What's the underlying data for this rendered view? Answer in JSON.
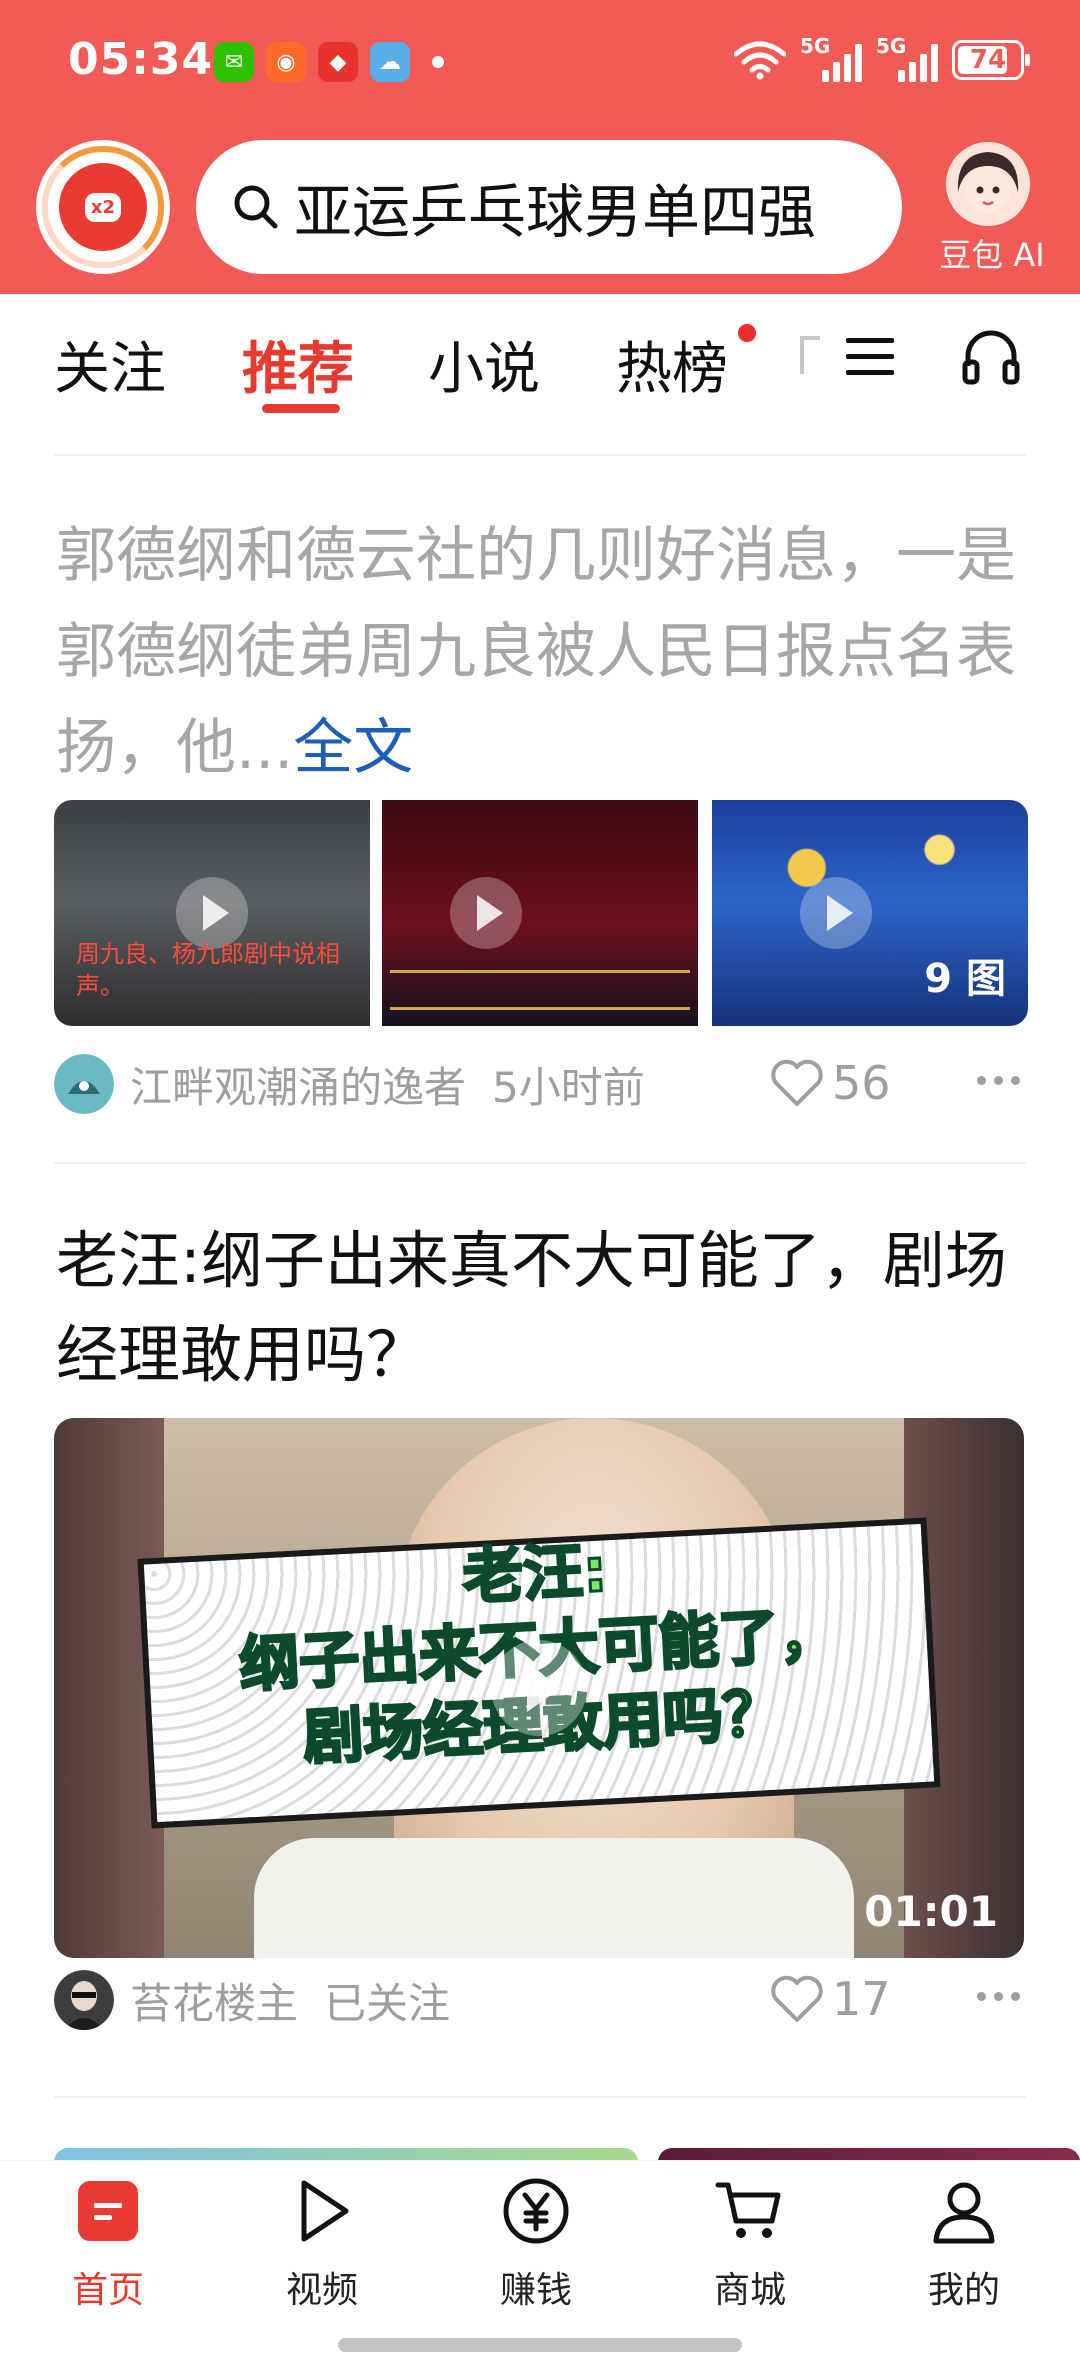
{
  "status_bar": {
    "time": "05:34",
    "network_1": "5G",
    "network_2": "5G",
    "battery": "74"
  },
  "header": {
    "search_query": "亚运乒乓球男单四强",
    "logo_badge": "x2",
    "ai_label": "豆包 AI"
  },
  "tabs": [
    {
      "label": "关注"
    },
    {
      "label": "推荐"
    },
    {
      "label": "小说"
    },
    {
      "label": "热榜"
    }
  ],
  "tab_partial": "",
  "feed": [
    {
      "text": "郭德纲和德云社的几则好消息，一是郭德纲徒弟周九良被人民日报点名表扬，他...",
      "more": "全文",
      "thumb1_caption": "周九良、杨九郎剧中说相声。",
      "thumb3_count": "9 图",
      "author": "江畔观潮涌的逸者",
      "time": "5小时前",
      "likes": "56"
    },
    {
      "title": "老汪:纲子出来真不大可能了，剧场经理敢用吗？",
      "video_overlay": "老汪:\n纲子出来不大可能了，\n剧场经理敢用吗？",
      "duration": "01:01",
      "author": "苔花楼主",
      "follow_status": "已关注",
      "likes": "17"
    }
  ],
  "bottom_nav": [
    {
      "label": "首页"
    },
    {
      "label": "视频"
    },
    {
      "label": "赚钱"
    },
    {
      "label": "商城"
    },
    {
      "label": "我的"
    }
  ],
  "colors": {
    "brand_red": "#f25a55",
    "active_tab": "#e8392f",
    "link_blue": "#1b5fb8"
  }
}
